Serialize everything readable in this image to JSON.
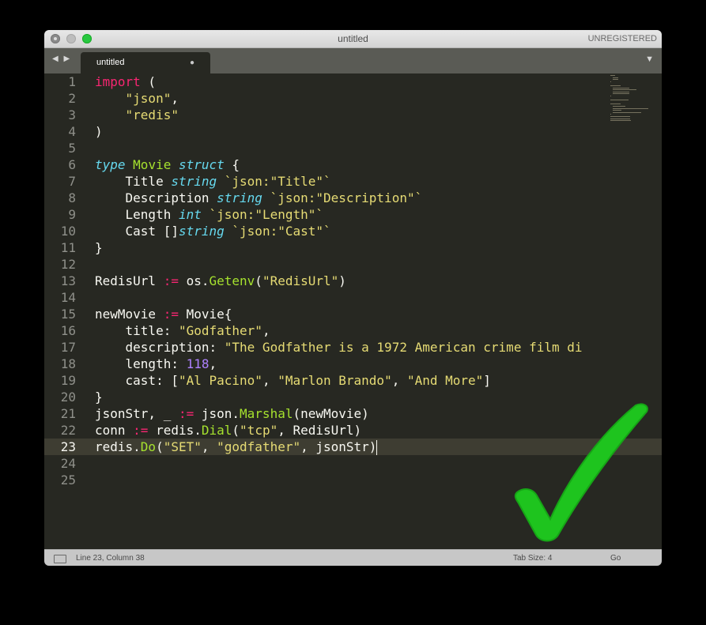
{
  "window": {
    "title": "untitled",
    "registration": "UNREGISTERED"
  },
  "tabbar": {
    "nav_label": "◀ ▶",
    "tabs": [
      {
        "label": "untitled",
        "close": "●"
      }
    ],
    "menu_label": "▼"
  },
  "editor": {
    "line_numbers": [
      "1",
      "2",
      "3",
      "4",
      "5",
      "6",
      "7",
      "8",
      "9",
      "10",
      "11",
      "12",
      "13",
      "14",
      "15",
      "16",
      "17",
      "18",
      "19",
      "20",
      "21",
      "22",
      "23",
      "24",
      "25"
    ],
    "current_line": 23,
    "lines": [
      "import (",
      "    \"json\",",
      "    \"redis\"",
      ")",
      "",
      "type Movie struct {",
      "    Title string `json:\"Title\"`",
      "    Description string `json:\"Description\"`",
      "    Length int `json:\"Length\"`",
      "    Cast []string `json:\"Cast\"`",
      "}",
      "",
      "RedisUrl := os.Getenv(\"RedisUrl\")",
      "",
      "newMovie := Movie{",
      "    title: \"Godfather\",",
      "    description: \"The Godfather is a 1972 American crime film di",
      "    length: 118,",
      "    cast: [\"Al Pacino\", \"Marlon Brando\", \"And More\"]",
      "}",
      "jsonStr, _ := json.Marshal(newMovie)",
      "conn := redis.Dial(\"tcp\", RedisUrl)",
      "redis.Do(\"SET\", \"godfather\", jsonStr)",
      "",
      ""
    ]
  },
  "statusbar": {
    "position": "Line 23, Column 38",
    "tab_size": "Tab Size: 4",
    "syntax": "Go"
  },
  "overlay": {
    "icon": "green-checkmark-icon"
  },
  "colors": {
    "background": "#272822",
    "foreground": "#f8f8f2",
    "keyword": "#f92672",
    "type": "#66d9ef",
    "function": "#a6e22e",
    "string": "#e6db74",
    "checkmark": "#1ec41e"
  }
}
